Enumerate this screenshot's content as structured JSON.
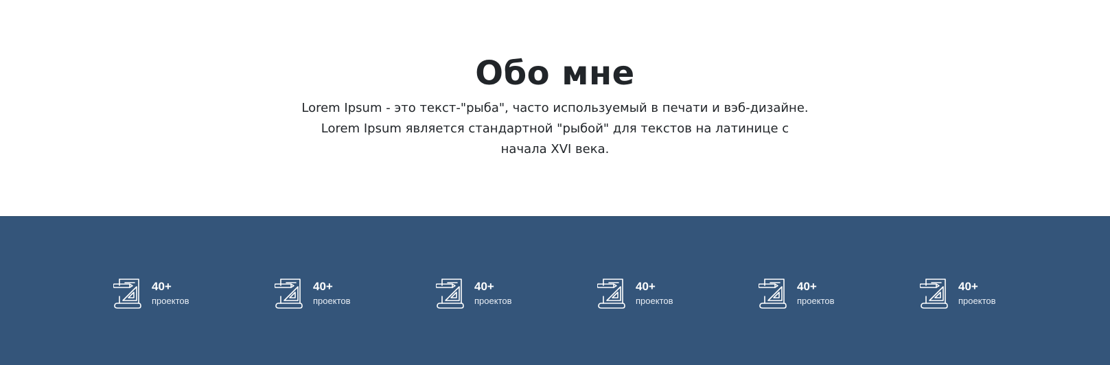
{
  "about": {
    "title": "Обо мне",
    "text": "Lorem Ipsum - это текст-\"рыба\", часто используемый в печати и вэб-дизайне. Lorem Ipsum является стандартной \"рыбой\" для текстов на латинице с начала XVI века."
  },
  "stats": [
    {
      "icon": "blueprint-icon",
      "value": "40+",
      "label": "проектов"
    },
    {
      "icon": "blueprint-icon",
      "value": "40+",
      "label": "проектов"
    },
    {
      "icon": "blueprint-icon",
      "value": "40+",
      "label": "проектов"
    },
    {
      "icon": "blueprint-icon",
      "value": "40+",
      "label": "проектов"
    },
    {
      "icon": "blueprint-icon",
      "value": "40+",
      "label": "проектов"
    },
    {
      "icon": "blueprint-icon",
      "value": "40+",
      "label": "проектов"
    }
  ],
  "colors": {
    "stats_background": "#34557a",
    "text": "#212529"
  }
}
